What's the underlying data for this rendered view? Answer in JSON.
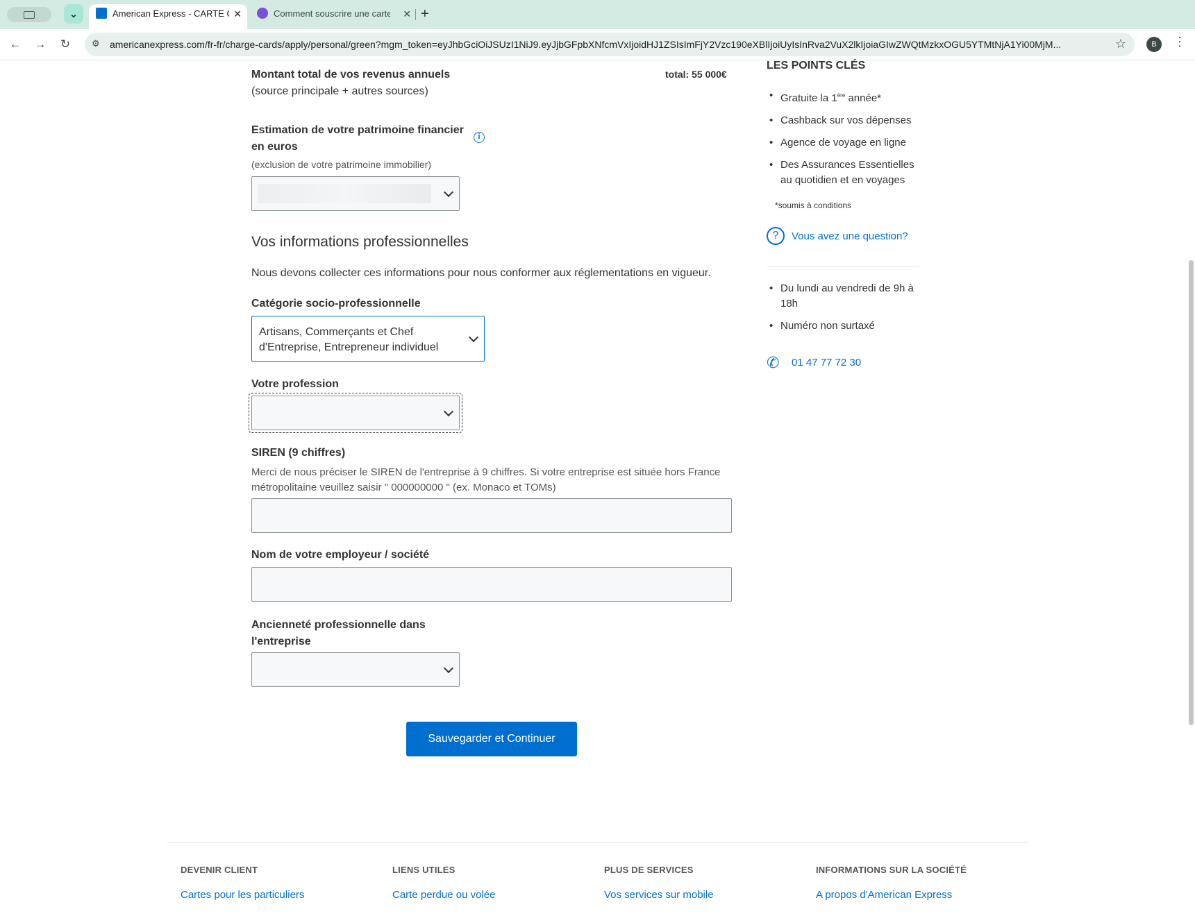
{
  "browser": {
    "tabs": [
      {
        "title": "American Express - CARTE G",
        "active": true
      },
      {
        "title": "Comment souscrire une carte",
        "active": false
      }
    ],
    "url": "americanexpress.com/fr-fr/charge-cards/apply/personal/green?mgm_token=eyJhbGciOiJSUzI1NiJ9.eyJjbGFpbXNfcmVxIjoidHJ1ZSIsImFjY2Vzc190eXBlIjoiUyIsInRva2VuX2lkIjoiaGIwZWQtMzkxOGU5YTMtNjA1Yi00MjM...",
    "avatar_letter": "B"
  },
  "form": {
    "income_label": "Montant total de vos revenus annuels",
    "income_sub": "(source principale + autres sources)",
    "income_total": "total: 55 000€",
    "wealth_label": "Estimation de votre patrimoine financier en euros",
    "wealth_sub": "(exclusion de votre patrimoine immobilier)",
    "section_title": "Vos informations professionnelles",
    "section_desc": "Nous devons collecter ces informations pour nous conformer aux réglementations en vigueur.",
    "category_label": "Catégorie socio-professionnelle",
    "category_value": "Artisans, Commerçants et Chef d'Entreprise, Entrepreneur individuel",
    "profession_label": "Votre profession",
    "siren_label": "SIREN (9 chiffres)",
    "siren_help": "Merci de nous préciser le SIREN de l'entreprise à 9 chiffres. Si votre entreprise est située hors France métropolitaine veuillez saisir \" 000000000 \" (ex. Monaco et TOMs)",
    "employer_label": "Nom de votre employeur / société",
    "seniority_label": "Ancienneté professionnelle dans l'entreprise",
    "submit_label": "Sauvegarder et Continuer"
  },
  "sidebar": {
    "title": "LES POINTS CLÉS",
    "points_first_prefix": "Gratuite la 1",
    "points_first_sup": "ère",
    "points_first_suffix": " année*",
    "points": [
      "Cashback sur vos dépenses",
      "Agence de voyage en ligne",
      "Des Assurances Essentielles au quotidien et en voyages"
    ],
    "conditions": "*soumis à conditions",
    "question_link": "Vous avez une question?",
    "hours": [
      "Du lundi au vendredi de 9h à 18h",
      "Numéro non surtaxé"
    ],
    "phone": "01 47 77 72 30"
  },
  "footer": {
    "columns": [
      {
        "title": "DEVENIR CLIENT",
        "link": "Cartes pour les particuliers"
      },
      {
        "title": "LIENS UTILES",
        "link": "Carte perdue ou volée"
      },
      {
        "title": "PLUS DE SERVICES",
        "link": "Vos services sur mobile"
      },
      {
        "title": "INFORMATIONS SUR LA SOCIÉTÉ",
        "link": "A propos d'American Express"
      }
    ]
  },
  "colors": {
    "accent": "#006fcf",
    "tabbar": "#d3ebe3"
  }
}
